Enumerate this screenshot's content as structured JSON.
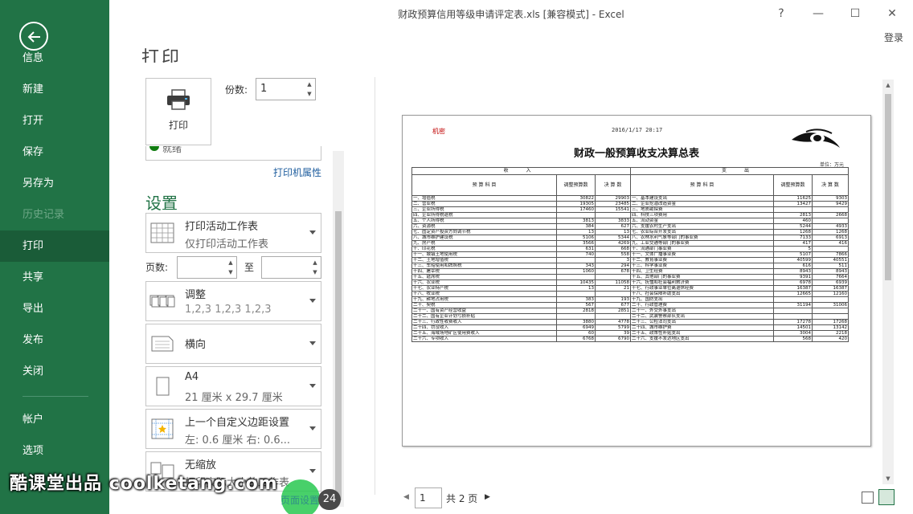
{
  "window": {
    "title": "财政预算信用等级申请评定表.xls  [兼容模式] - Excel",
    "help": "?",
    "minimize": "—",
    "restore": "☐",
    "close": "✕",
    "login": "登录"
  },
  "sidebar": {
    "items": [
      {
        "label": "信息"
      },
      {
        "label": "新建"
      },
      {
        "label": "打开"
      },
      {
        "label": "保存"
      },
      {
        "label": "另存为"
      },
      {
        "label": "历史记录"
      },
      {
        "label": "打印"
      },
      {
        "label": "共享"
      },
      {
        "label": "导出"
      },
      {
        "label": "发布"
      },
      {
        "label": "关闭"
      },
      {
        "label": "帐户"
      },
      {
        "label": "选项"
      }
    ],
    "active": "打印",
    "accent": "#217346"
  },
  "print": {
    "heading": "打印",
    "button_label": "打印",
    "copies_label": "份数:",
    "copies_value": "1",
    "printer_status": "就绪",
    "printer_properties": "打印机属性",
    "settings_title": "设置",
    "pages_label": "页数:",
    "pages_to": "至",
    "options": {
      "scope": {
        "title": "打印活动工作表",
        "sub": "仅打印活动工作表"
      },
      "collate": {
        "title": "调整",
        "sub": "1,2,3    1,2,3    1,2,3"
      },
      "orientation": {
        "title": "横向",
        "sub": ""
      },
      "paper": {
        "title": "A4",
        "sub": "21 厘米 x 29.7 厘米"
      },
      "margins": {
        "title": "上一个自定义边距设置",
        "sub": "左: 0.6 厘米    右: 0.6..."
      },
      "scaling": {
        "title": "无缩放",
        "sub": "打印实际大小的工作表"
      }
    },
    "page_setup_link": "页面设置"
  },
  "preview": {
    "secret": "机密",
    "datetime": "2016/1/17 20:17",
    "title": "财政一般预算收支决算总表",
    "unit": "单位：万元",
    "head_income": "收          入",
    "head_expense": "支          出",
    "col_item_in": "预    算    科    目",
    "col_adj_in": "调整预算数",
    "col_final_in": "决 算 数",
    "col_item_ex": "预    算    科    目",
    "col_adj_ex": "调整预算数",
    "col_final_ex": "决 算 数",
    "rows": [
      [
        "一、增值税",
        "30822",
        "29903",
        "一、基本建设支出",
        "11625",
        "9303"
      ],
      [
        "二、营业税",
        "19305",
        "23485",
        "二、企业挖潜改造资金",
        "13427",
        "9429"
      ],
      [
        "三、企业所得税",
        "17460",
        "15541",
        "三、地质勘探费",
        "",
        ""
      ],
      [
        "四、企业所得税退税",
        "",
        "",
        "四、科技三项费用",
        "2813",
        "2668"
      ],
      [
        "五、个人所得税",
        "3813",
        "3833",
        "五、流动资金",
        "460",
        ""
      ],
      [
        "六、资源税",
        "384",
        "627",
        "六、支援农村生产支出",
        "5244",
        "4933"
      ],
      [
        "七、固定资产投资方向调节税",
        "13",
        "13",
        "七、农业综合开发支出",
        "1268",
        "1268"
      ],
      [
        "八、城市维护建设税",
        "5106",
        "5344",
        "八、农林水利气象等部门的事业费",
        "7133",
        "6913"
      ],
      [
        "九、房产税",
        "3566",
        "4269",
        "九、工业交通等部门的事业费",
        "417",
        "416"
      ],
      [
        "十、印花税",
        "631",
        "668",
        "十、流通部门事业费",
        "5",
        ""
      ],
      [
        "十一、城镇土地使用税",
        "740",
        "558",
        "十一、文体广播事业费",
        "5107",
        "7866"
      ],
      [
        "十二、土地增值税",
        "",
        "3",
        "十二、教育事业费",
        "40599",
        "40551"
      ],
      [
        "十三、车船使用和牌照税",
        "343",
        "294",
        "十三、科学事业费",
        "616",
        "511"
      ],
      [
        "十四、屠宰税",
        "1060",
        "678",
        "十四、卫生经费",
        "8943",
        "8943"
      ],
      [
        "十五、筵席税",
        "",
        "",
        "十五、其他部门的事业费",
        "9391",
        "7664"
      ],
      [
        "十六、农业税",
        "10435",
        "11058",
        "十六、抚恤和社会福利救济费",
        "6978",
        "6939"
      ],
      [
        "十七、农业特产税",
        "13",
        "21",
        "十七、行政事业单位离退休经费",
        "16387",
        "16387"
      ],
      [
        "十八、牧业税",
        "",
        "",
        "十八、社会保障补助支出",
        "12665",
        "12160"
      ],
      [
        "十九、耕地占用税",
        "383",
        "193",
        "十九、国防支出",
        "",
        ""
      ],
      [
        "二十、契税",
        "567",
        "677",
        "二十、行政管理费",
        "31194",
        "31006"
      ],
      [
        "二十一、国有资产经营收益",
        "2818",
        "2851",
        "二十一、外交外事支出",
        "",
        ""
      ],
      [
        "二十二、国有企业计划亏损补贴",
        "",
        "",
        "二十二、武装警察部队支出",
        "",
        ""
      ],
      [
        "二十三、行政性收费收入",
        "3880",
        "4778",
        "二十三、公检法司支出",
        "17278",
        "17268"
      ],
      [
        "二十四、罚没收入",
        "6949",
        "5799",
        "二十四、城市维护费",
        "14501",
        "13142"
      ],
      [
        "二十五、海域场地矿区使用费收入",
        "60",
        "39",
        "二十五、政策性补贴支出",
        "3004",
        "2218"
      ],
      [
        "二十六、专项收入",
        "6768",
        "6790",
        "二十六、支援不发达地区支出",
        "568",
        "420"
      ]
    ]
  },
  "navigation": {
    "current_page": "1",
    "total": "共 2 页"
  },
  "overlay": {
    "watermark": "酷课堂出品 coolketang.com",
    "step": "24"
  }
}
